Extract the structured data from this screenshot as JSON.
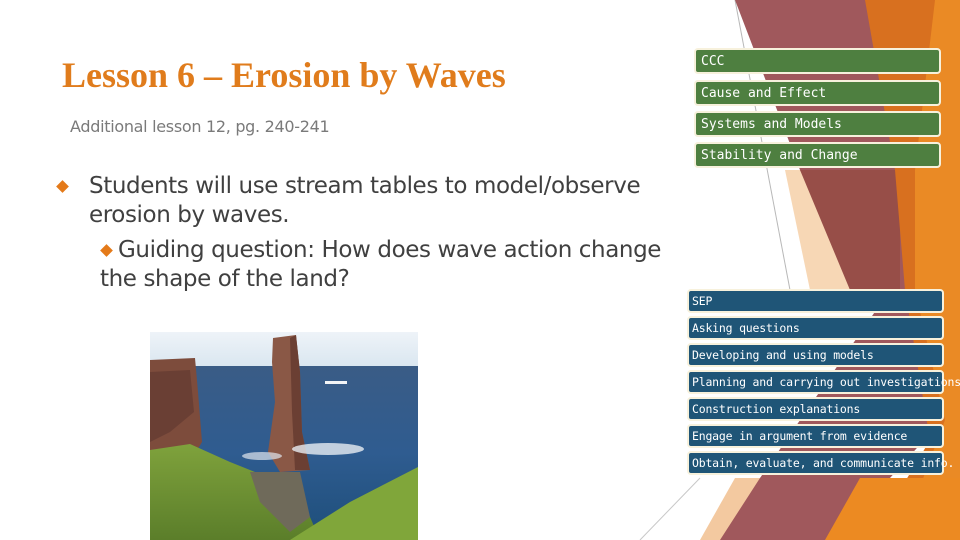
{
  "slide": {
    "title": "Lesson 6 – Erosion by Waves",
    "subtitle": "Additional lesson 12, pg. 240-241",
    "bullets": [
      {
        "level": 1,
        "text": "Students will use stream tables to model/observe erosion by waves."
      },
      {
        "level": 2,
        "text_line1": "Guiding question: How does wave action change",
        "text_line2": "the shape of the land?"
      }
    ],
    "photo": {
      "description": "Coastal sea stack (Old Man of Hoy) with cliffs, ocean and green grass"
    },
    "ccc_panel": {
      "header": "CCC",
      "items": [
        "Cause and Effect",
        "Systems and Models",
        "Stability and Change"
      ]
    },
    "sep_panel": {
      "header": "SEP",
      "items": [
        "Asking questions",
        "Developing and using models",
        "Planning and carrying out investigations",
        "Construction explanations",
        "Engage in argument from evidence",
        "Obtain, evaluate, and communicate info."
      ]
    },
    "colors": {
      "title": "#e07c1c",
      "bullet": "#e47a1a",
      "ccc_box": "#4e7f40",
      "sep_box": "#1f5577",
      "box_border": "#f7f1dc",
      "mauve": "#9c5a5c",
      "orange_dark": "#d8701f",
      "orange_bright": "#ea8a25"
    }
  }
}
